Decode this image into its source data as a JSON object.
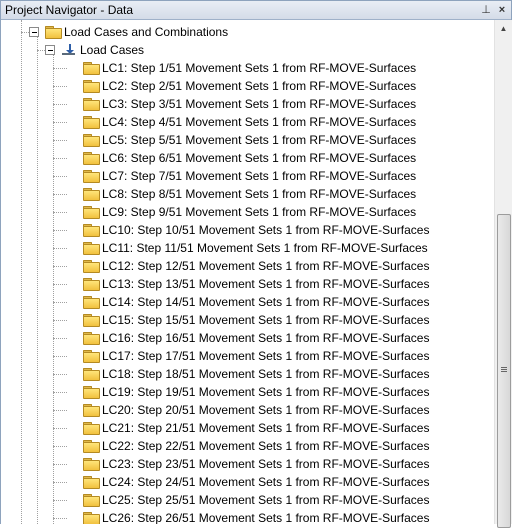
{
  "window": {
    "title": "Project Navigator - Data",
    "pin_icon": "pin-icon",
    "close_icon": "close-icon"
  },
  "tree": {
    "root": {
      "label": "Load Cases and Combinations",
      "icon": "folder-icon",
      "expanded": true
    },
    "load_cases_group": {
      "label": "Load Cases",
      "icon": "load-case-icon",
      "expanded": true
    },
    "items": [
      {
        "label": "LC1: Step 1/51 Movement Sets 1 from RF-MOVE-Surfaces"
      },
      {
        "label": "LC2: Step 2/51 Movement Sets 1 from RF-MOVE-Surfaces"
      },
      {
        "label": "LC3: Step 3/51 Movement Sets 1 from RF-MOVE-Surfaces"
      },
      {
        "label": "LC4: Step 4/51 Movement Sets 1 from RF-MOVE-Surfaces"
      },
      {
        "label": "LC5: Step 5/51 Movement Sets 1 from RF-MOVE-Surfaces"
      },
      {
        "label": "LC6: Step 6/51 Movement Sets 1 from RF-MOVE-Surfaces"
      },
      {
        "label": "LC7: Step 7/51 Movement Sets 1 from RF-MOVE-Surfaces"
      },
      {
        "label": "LC8: Step 8/51 Movement Sets 1 from RF-MOVE-Surfaces"
      },
      {
        "label": "LC9: Step 9/51 Movement Sets 1 from RF-MOVE-Surfaces"
      },
      {
        "label": "LC10: Step 10/51 Movement Sets 1 from RF-MOVE-Surfaces"
      },
      {
        "label": "LC11: Step 11/51 Movement Sets 1 from RF-MOVE-Surfaces"
      },
      {
        "label": "LC12: Step 12/51 Movement Sets 1 from RF-MOVE-Surfaces"
      },
      {
        "label": "LC13: Step 13/51 Movement Sets 1 from RF-MOVE-Surfaces"
      },
      {
        "label": "LC14: Step 14/51 Movement Sets 1 from RF-MOVE-Surfaces"
      },
      {
        "label": "LC15: Step 15/51 Movement Sets 1 from RF-MOVE-Surfaces"
      },
      {
        "label": "LC16: Step 16/51 Movement Sets 1 from RF-MOVE-Surfaces"
      },
      {
        "label": "LC17: Step 17/51 Movement Sets 1 from RF-MOVE-Surfaces"
      },
      {
        "label": "LC18: Step 18/51 Movement Sets 1 from RF-MOVE-Surfaces"
      },
      {
        "label": "LC19: Step 19/51 Movement Sets 1 from RF-MOVE-Surfaces"
      },
      {
        "label": "LC20: Step 20/51 Movement Sets 1 from RF-MOVE-Surfaces"
      },
      {
        "label": "LC21: Step 21/51 Movement Sets 1 from RF-MOVE-Surfaces"
      },
      {
        "label": "LC22: Step 22/51 Movement Sets 1 from RF-MOVE-Surfaces"
      },
      {
        "label": "LC23: Step 23/51 Movement Sets 1 from RF-MOVE-Surfaces"
      },
      {
        "label": "LC24: Step 24/51 Movement Sets 1 from RF-MOVE-Surfaces"
      },
      {
        "label": "LC25: Step 25/51 Movement Sets 1 from RF-MOVE-Surfaces"
      },
      {
        "label": "LC26: Step 26/51 Movement Sets 1 from RF-MOVE-Surfaces"
      }
    ],
    "item_icon": "folder-icon"
  },
  "scrollbar": {
    "up_icon": "scroll-up-arrow-icon",
    "grip_icon": "scroll-grip-icon"
  },
  "colors": {
    "titlebar": "#d4dce8",
    "folder": "#f1c13e",
    "tree_lines": "#a0a0a0"
  }
}
